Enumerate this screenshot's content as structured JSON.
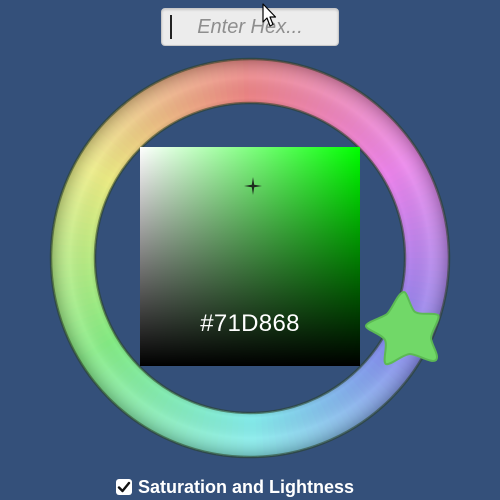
{
  "hex_input": {
    "value": "",
    "placeholder": "Enter Hex..."
  },
  "selected_color": {
    "hex_label": "#71D868",
    "swatch": "#71d868",
    "hue_corner": "#00ff00"
  },
  "mode_toggle": {
    "label": "Saturation and Lightness",
    "checked": true
  },
  "colors": {
    "background": "#34507a",
    "handle_fill": "#71d868"
  }
}
